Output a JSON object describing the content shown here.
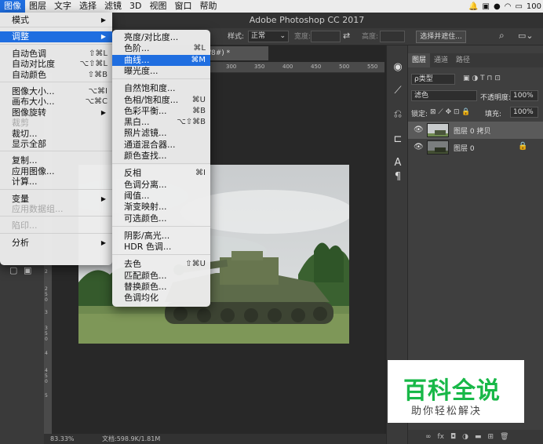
{
  "menubar": {
    "items": [
      "图像",
      "图层",
      "文字",
      "选择",
      "滤镜",
      "3D",
      "视图",
      "窗口",
      "帮助"
    ],
    "battery": "100"
  },
  "titlebar": {
    "title": "Adobe Photoshop CC 2017"
  },
  "options": {
    "style_label": "样式:",
    "style_value": "正常",
    "width_label": "宽度:",
    "height_label": "高度:",
    "select_mask": "选择并遮住..."
  },
  "doc_tab": "/8#) *",
  "ruler_h": [
    "300",
    "350",
    "400",
    "450",
    "500",
    "550"
  ],
  "ruler_v": [
    "2",
    "2 5 0",
    "3",
    "3 5 0",
    "4",
    "4 5 0",
    "5"
  ],
  "status": {
    "zoom": "83.33%",
    "doc": "文档:598.9K/1.81M"
  },
  "image_menu": [
    {
      "label": "模式",
      "arrow": "▶"
    },
    {
      "sep": true
    },
    {
      "label": "调整",
      "arrow": "▶",
      "hl": true
    },
    {
      "sep": true
    },
    {
      "label": "自动色调",
      "sc": "⇧⌘L"
    },
    {
      "label": "自动对比度",
      "sc": "⌥⇧⌘L"
    },
    {
      "label": "自动颜色",
      "sc": "⇧⌘B"
    },
    {
      "sep": true
    },
    {
      "label": "图像大小...",
      "sc": "⌥⌘I"
    },
    {
      "label": "画布大小...",
      "sc": "⌥⌘C"
    },
    {
      "label": "图像旋转",
      "arrow": "▶"
    },
    {
      "label": "裁剪",
      "dis": true
    },
    {
      "label": "裁切..."
    },
    {
      "label": "显示全部"
    },
    {
      "sep": true
    },
    {
      "label": "复制..."
    },
    {
      "label": "应用图像..."
    },
    {
      "label": "计算..."
    },
    {
      "sep": true
    },
    {
      "label": "变量",
      "arrow": "▶"
    },
    {
      "label": "应用数据组...",
      "dis": true
    },
    {
      "sep": true
    },
    {
      "label": "陷印...",
      "dis": true
    },
    {
      "sep": true
    },
    {
      "label": "分析",
      "arrow": "▶"
    }
  ],
  "adjust_menu": [
    {
      "label": "亮度/对比度..."
    },
    {
      "label": "色阶...",
      "sc": "⌘L"
    },
    {
      "label": "曲线...",
      "sc": "⌘M",
      "hl": true
    },
    {
      "label": "曝光度..."
    },
    {
      "sep": true
    },
    {
      "label": "自然饱和度..."
    },
    {
      "label": "色相/饱和度...",
      "sc": "⌘U"
    },
    {
      "label": "色彩平衡...",
      "sc": "⌘B"
    },
    {
      "label": "黑白...",
      "sc": "⌥⇧⌘B"
    },
    {
      "label": "照片滤镜..."
    },
    {
      "label": "通道混合器..."
    },
    {
      "label": "颜色查找..."
    },
    {
      "sep": true
    },
    {
      "label": "反相",
      "sc": "⌘I"
    },
    {
      "label": "色调分离..."
    },
    {
      "label": "阈值..."
    },
    {
      "label": "渐变映射..."
    },
    {
      "label": "可选颜色..."
    },
    {
      "sep": true
    },
    {
      "label": "阴影/高光..."
    },
    {
      "label": "HDR 色调..."
    },
    {
      "sep": true
    },
    {
      "label": "去色",
      "sc": "⇧⌘U"
    },
    {
      "label": "匹配颜色..."
    },
    {
      "label": "替换颜色..."
    },
    {
      "label": "色调均化"
    }
  ],
  "layers_panel": {
    "tabs": [
      "图层",
      "通道",
      "路径"
    ],
    "kind": "ρ类型",
    "blend": "滤色",
    "opacity_label": "不透明度:",
    "opacity": "100%",
    "lock_label": "锁定:",
    "fill_label": "填充:",
    "fill": "100%",
    "layers": [
      "图层 0 拷贝",
      "图层 0"
    ],
    "bottom": [
      "∞",
      "fx"
    ]
  },
  "watermark": {
    "title": "百科全说",
    "subtitle": "助你轻松解决"
  },
  "colors": {
    "accent": "#1f6ee0",
    "watermark_green": "#18b848"
  }
}
